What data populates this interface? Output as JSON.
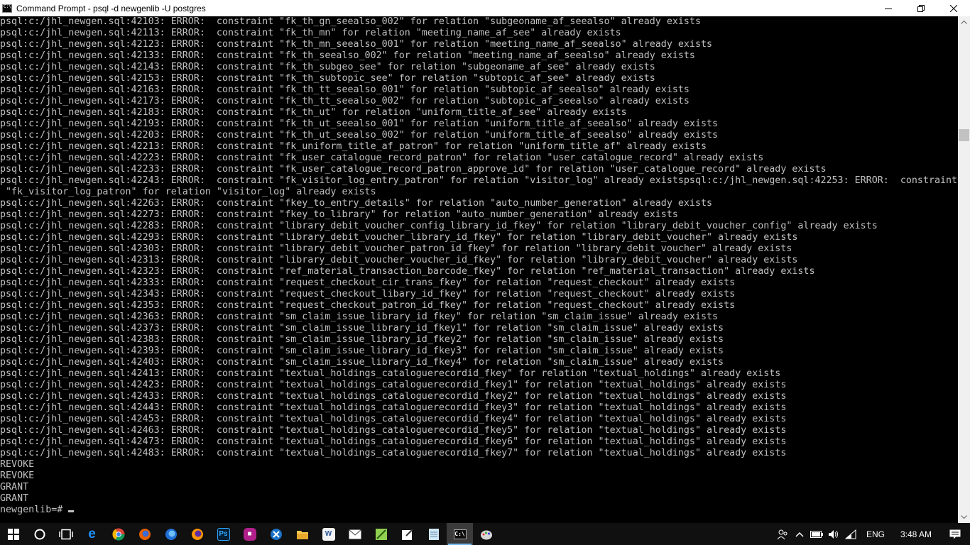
{
  "window": {
    "title": "Command Prompt - psql  -d newgenlib -U postgres",
    "controls": {
      "minimize": "minimize",
      "maximize": "maximize",
      "close": "close"
    }
  },
  "console": {
    "lines": [
      "psql:c:/jhl_newgen.sql:42103: ERROR:  constraint \"fk_th_gn_seealso_002\" for relation \"subgeoname_af_seealso\" already exists",
      "psql:c:/jhl_newgen.sql:42113: ERROR:  constraint \"fk_th_mn\" for relation \"meeting_name_af_see\" already exists",
      "psql:c:/jhl_newgen.sql:42123: ERROR:  constraint \"fk_th_mn_seealso_001\" for relation \"meeting_name_af_seealso\" already exists",
      "psql:c:/jhl_newgen.sql:42133: ERROR:  constraint \"fk_th_seealso_002\" for relation \"meeting_name_af_seealso\" already exists",
      "psql:c:/jhl_newgen.sql:42143: ERROR:  constraint \"fk_th_subgeo_see\" for relation \"subgeoname_af_see\" already exists",
      "psql:c:/jhl_newgen.sql:42153: ERROR:  constraint \"fk_th_subtopic_see\" for relation \"subtopic_af_see\" already exists",
      "psql:c:/jhl_newgen.sql:42163: ERROR:  constraint \"fk_th_tt_seealso_001\" for relation \"subtopic_af_seealso\" already exists",
      "psql:c:/jhl_newgen.sql:42173: ERROR:  constraint \"fk_th_tt_seealso_002\" for relation \"subtopic_af_seealso\" already exists",
      "psql:c:/jhl_newgen.sql:42183: ERROR:  constraint \"fk_th_ut\" for relation \"uniform_title_af_see\" already exists",
      "psql:c:/jhl_newgen.sql:42193: ERROR:  constraint \"fk_th_ut_seealso_001\" for relation \"uniform_title_af_seealso\" already exists",
      "psql:c:/jhl_newgen.sql:42203: ERROR:  constraint \"fk_th_ut_seealso_002\" for relation \"uniform_title_af_seealso\" already exists",
      "psql:c:/jhl_newgen.sql:42213: ERROR:  constraint \"fk_uniform_title_af_patron\" for relation \"uniform_title_af\" already exists",
      "psql:c:/jhl_newgen.sql:42223: ERROR:  constraint \"fk_user_catalogue_record_patron\" for relation \"user_catalogue_record\" already exists",
      "psql:c:/jhl_newgen.sql:42233: ERROR:  constraint \"fk_user_catalogue_record_patron_approve_id\" for relation \"user_catalogue_record\" already exists",
      "psql:c:/jhl_newgen.sql:42243: ERROR:  constraint \"fk_visitor_log_entry_patron\" for relation \"visitor_log\" already existspsql:c:/jhl_newgen.sql:42253: ERROR:  constraint",
      " \"fk_visitor_log_patron\" for relation \"visitor_log\" already exists",
      "psql:c:/jhl_newgen.sql:42263: ERROR:  constraint \"fkey_to_entry_details\" for relation \"auto_number_generation\" already exists",
      "psql:c:/jhl_newgen.sql:42273: ERROR:  constraint \"fkey_to_library\" for relation \"auto_number_generation\" already exists",
      "psql:c:/jhl_newgen.sql:42283: ERROR:  constraint \"library_debit_voucher_config_library_id_fkey\" for relation \"library_debit_voucher_config\" already exists",
      "psql:c:/jhl_newgen.sql:42293: ERROR:  constraint \"library_debit_voucher_library_id_fkey\" for relation \"library_debit_voucher\" already exists",
      "psql:c:/jhl_newgen.sql:42303: ERROR:  constraint \"library_debit_voucher_patron_id_fkey\" for relation \"library_debit_voucher\" already exists",
      "psql:c:/jhl_newgen.sql:42313: ERROR:  constraint \"library_debit_voucher_voucher_id_fkey\" for relation \"library_debit_voucher\" already exists",
      "psql:c:/jhl_newgen.sql:42323: ERROR:  constraint \"ref_material_transaction_barcode_fkey\" for relation \"ref_material_transaction\" already exists",
      "psql:c:/jhl_newgen.sql:42333: ERROR:  constraint \"request_checkout_cir_trans_fkey\" for relation \"request_checkout\" already exists",
      "psql:c:/jhl_newgen.sql:42343: ERROR:  constraint \"request_checkout_libary_id_fkey\" for relation \"request_checkout\" already exists",
      "psql:c:/jhl_newgen.sql:42353: ERROR:  constraint \"request_checkout_patron_id_fkey\" for relation \"request_checkout\" already exists",
      "psql:c:/jhl_newgen.sql:42363: ERROR:  constraint \"sm_claim_issue_library_id_fkey\" for relation \"sm_claim_issue\" already exists",
      "psql:c:/jhl_newgen.sql:42373: ERROR:  constraint \"sm_claim_issue_library_id_fkey1\" for relation \"sm_claim_issue\" already exists",
      "psql:c:/jhl_newgen.sql:42383: ERROR:  constraint \"sm_claim_issue_library_id_fkey2\" for relation \"sm_claim_issue\" already exists",
      "psql:c:/jhl_newgen.sql:42393: ERROR:  constraint \"sm_claim_issue_library_id_fkey3\" for relation \"sm_claim_issue\" already exists",
      "psql:c:/jhl_newgen.sql:42403: ERROR:  constraint \"sm_claim_issue_library_id_fkey4\" for relation \"sm_claim_issue\" already exists",
      "psql:c:/jhl_newgen.sql:42413: ERROR:  constraint \"textual_holdings_cataloguerecordid_fkey\" for relation \"textual_holdings\" already exists",
      "psql:c:/jhl_newgen.sql:42423: ERROR:  constraint \"textual_holdings_cataloguerecordid_fkey1\" for relation \"textual_holdings\" already exists",
      "psql:c:/jhl_newgen.sql:42433: ERROR:  constraint \"textual_holdings_cataloguerecordid_fkey2\" for relation \"textual_holdings\" already exists",
      "psql:c:/jhl_newgen.sql:42443: ERROR:  constraint \"textual_holdings_cataloguerecordid_fkey3\" for relation \"textual_holdings\" already exists",
      "psql:c:/jhl_newgen.sql:42453: ERROR:  constraint \"textual_holdings_cataloguerecordid_fkey4\" for relation \"textual_holdings\" already exists",
      "psql:c:/jhl_newgen.sql:42463: ERROR:  constraint \"textual_holdings_cataloguerecordid_fkey5\" for relation \"textual_holdings\" already exists",
      "psql:c:/jhl_newgen.sql:42473: ERROR:  constraint \"textual_holdings_cataloguerecordid_fkey6\" for relation \"textual_holdings\" already exists",
      "psql:c:/jhl_newgen.sql:42483: ERROR:  constraint \"textual_holdings_cataloguerecordid_fkey7\" for relation \"textual_holdings\" already exists",
      "REVOKE",
      "REVOKE",
      "GRANT",
      "GRANT"
    ],
    "prompt": "newgenlib=#",
    "text_color": "#c0c0c0",
    "background_color": "#000000"
  },
  "taskbar": {
    "apps": [
      {
        "name": "windows-start",
        "icon": "windows-logo-icon"
      },
      {
        "name": "cortana",
        "icon": "cortana-circle-icon"
      },
      {
        "name": "task-view",
        "icon": "task-view-icon"
      },
      {
        "name": "edge",
        "icon": "edge-icon"
      },
      {
        "name": "chrome",
        "icon": "chrome-icon"
      },
      {
        "name": "firefox-alt",
        "icon": "firefox-nightly-icon"
      },
      {
        "name": "firefox-dev",
        "icon": "firefox-developer-icon"
      },
      {
        "name": "firefox",
        "icon": "firefox-icon"
      },
      {
        "name": "photoshop",
        "icon": "photoshop-icon",
        "label": "Ps"
      },
      {
        "name": "media-app",
        "icon": "media-app-icon"
      },
      {
        "name": "tool-x",
        "icon": "x-tool-icon"
      },
      {
        "name": "file-explorer",
        "icon": "folder-icon"
      },
      {
        "name": "word",
        "icon": "word-icon",
        "label": "W"
      },
      {
        "name": "mail",
        "icon": "mail-icon"
      },
      {
        "name": "notepad-pp",
        "icon": "notepadpp-icon"
      },
      {
        "name": "sticky-notes",
        "icon": "sticky-notes-icon"
      },
      {
        "name": "notepad",
        "icon": "notepad-icon"
      },
      {
        "name": "command-prompt",
        "icon": "cmd-icon",
        "label": "C:\\"
      },
      {
        "name": "paint",
        "icon": "paint-icon"
      }
    ],
    "tray": {
      "language": "ENG",
      "time": "3:48 AM",
      "icons": [
        "people-icon",
        "chevron-up-icon",
        "battery-icon",
        "volume-icon",
        "wifi-icon"
      ]
    },
    "colors": {
      "background": "#101010",
      "active_underline": "#76b9ed"
    }
  }
}
